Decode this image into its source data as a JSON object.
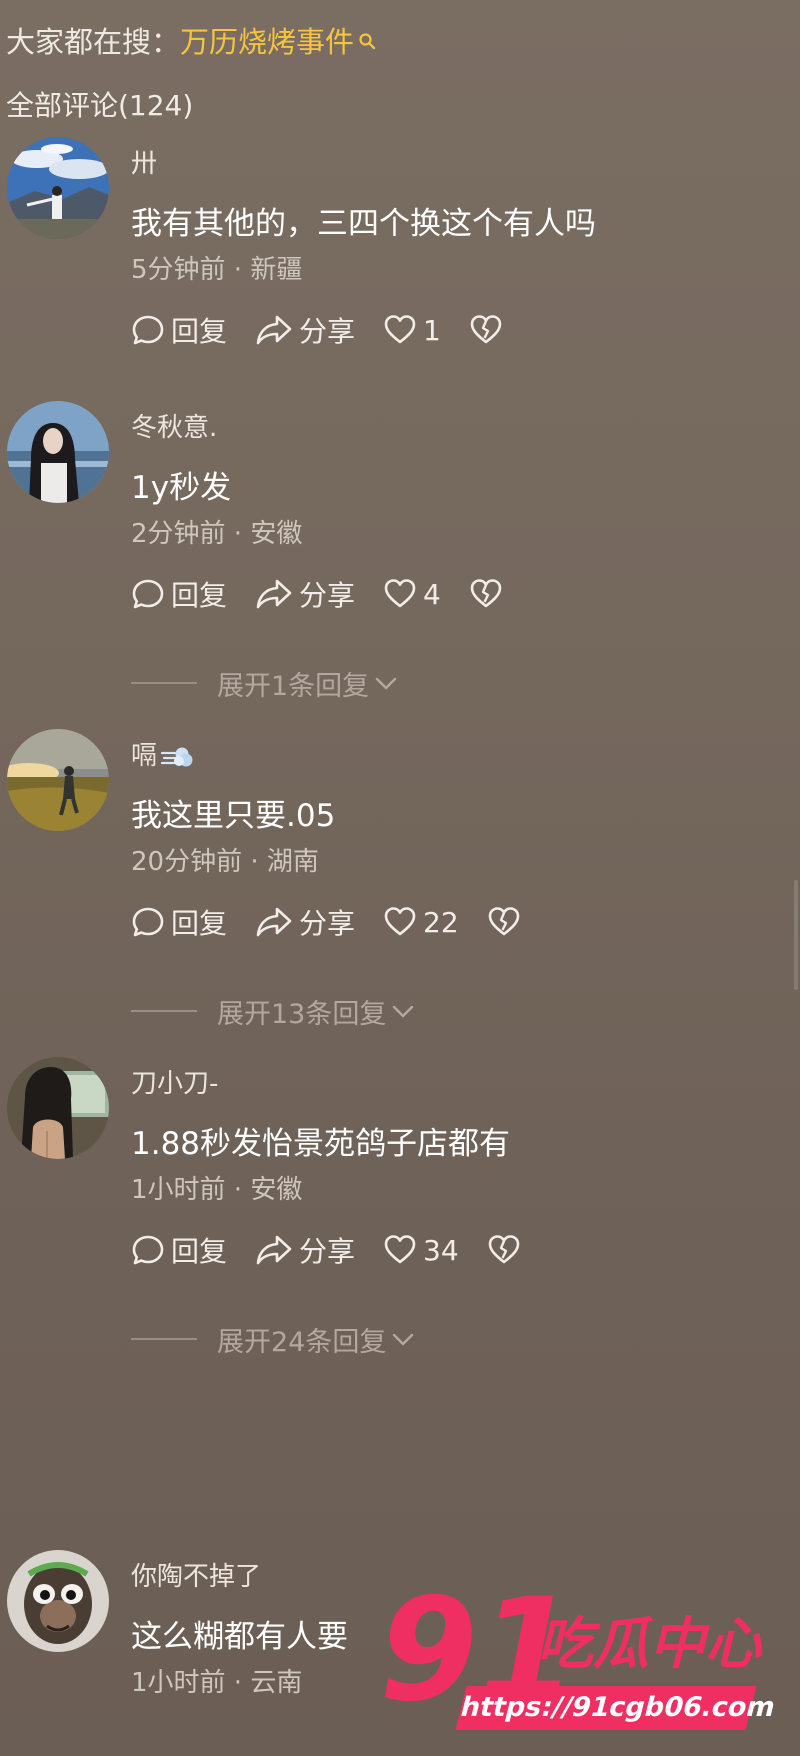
{
  "search_hint": {
    "label": "大家都在搜：",
    "term": "万历烧烤事件",
    "icon": "search-icon"
  },
  "section_title": "全部评论(124)",
  "action_labels": {
    "reply": "回复",
    "share": "分享"
  },
  "comments": [
    {
      "user": "卅",
      "text": "我有其他的，三四个换这个有人吗",
      "meta": "5分钟前 · 新疆",
      "likes": "1",
      "avatar": "sky-landscape"
    },
    {
      "user": "冬秋意.",
      "text": "1y秒发",
      "meta": "2分钟前 · 安徽",
      "likes": "4",
      "expand": "展开1条回复",
      "avatar": "girl-portrait"
    },
    {
      "user": "嗝",
      "text": "我这里只要.05",
      "meta": "20分钟前 · 湖南",
      "likes": "22",
      "expand": "展开13条回复",
      "avatar": "field-sunset"
    },
    {
      "user": "刀小刀-",
      "text": "1.88秒发怡景苑鸽子店都有",
      "meta": "1小时前 · 安徽",
      "likes": "34",
      "expand": "展开24条回复",
      "avatar": "woman-back"
    },
    {
      "user": "你陶不掉了",
      "text": "这么糊都有人要",
      "meta": "1小时前 · 云南",
      "avatar": "masked-face"
    }
  ],
  "watermark": {
    "number": "91",
    "title": "吃瓜中心",
    "url": "https://91cgb06.com"
  },
  "colors": {
    "background": "#75685d",
    "accent": "#f6c441",
    "watermark": "#ef2f62"
  }
}
